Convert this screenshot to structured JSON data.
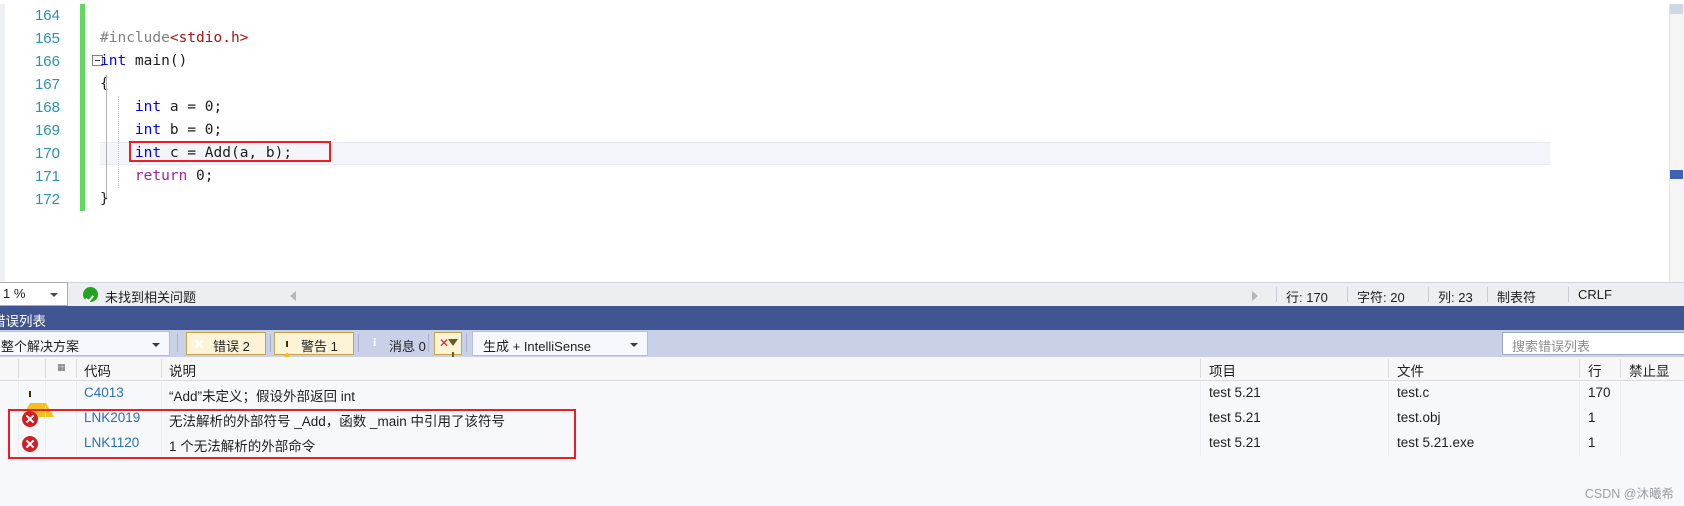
{
  "editor": {
    "lines": [
      {
        "num": "164",
        "tokens": [],
        "changed": true
      },
      {
        "num": "165",
        "tokens": [
          {
            "t": "#include",
            "c": "pp"
          },
          {
            "t": "<stdio.h>",
            "c": "str"
          }
        ],
        "changed": true
      },
      {
        "num": "166",
        "tokens": [
          {
            "t": "int",
            "c": "kw"
          },
          {
            "t": " main()",
            "c": "plain"
          }
        ],
        "changed": true
      },
      {
        "num": "167",
        "tokens": [
          {
            "t": "{",
            "c": "plain"
          }
        ],
        "changed": true
      },
      {
        "num": "168",
        "tokens": [
          {
            "t": "    ",
            "c": "plain"
          },
          {
            "t": "int",
            "c": "kw"
          },
          {
            "t": " a = 0;",
            "c": "plain"
          }
        ],
        "changed": true
      },
      {
        "num": "169",
        "tokens": [
          {
            "t": "    ",
            "c": "plain"
          },
          {
            "t": "int",
            "c": "kw"
          },
          {
            "t": " b = 0;",
            "c": "plain"
          }
        ],
        "changed": true
      },
      {
        "num": "170",
        "tokens": [
          {
            "t": "    ",
            "c": "plain"
          },
          {
            "t": "int",
            "c": "kw"
          },
          {
            "t": " c = Add(a, b);",
            "c": "plain"
          }
        ],
        "changed": true
      },
      {
        "num": "171",
        "tokens": [
          {
            "t": "    ",
            "c": "plain"
          },
          {
            "t": "return",
            "c": "kw2"
          },
          {
            "t": " 0;",
            "c": "plain"
          }
        ],
        "changed": true
      },
      {
        "num": "172",
        "tokens": [
          {
            "t": "}",
            "c": "plain"
          }
        ],
        "changed": true
      }
    ],
    "highlight_line_index": 6,
    "collapse_glyph_line_index": 2
  },
  "status_bar": {
    "zoom_value": "1 %",
    "issues_text": "未找到相关问题",
    "line_label": "行: 170",
    "char_label": "字符: 20",
    "col_label": "列: 23",
    "tab_label": "制表符",
    "eol_label": "CRLF"
  },
  "error_panel": {
    "title": "错误列表",
    "scope_value": "整个解决方案",
    "toggles": [
      {
        "icon": "error-icon",
        "label": "错误 2"
      },
      {
        "icon": "warning-icon",
        "label": "警告 1"
      },
      {
        "icon": "info-icon",
        "label": "消息 0"
      }
    ],
    "filter_icon": "clear-filter-icon",
    "build_value": "生成 + IntelliSense",
    "search_placeholder": "搜索错误列表",
    "columns": {
      "code": "代码",
      "description": "说明",
      "project": "项目",
      "file": "文件",
      "line": "行",
      "suppress": "禁止显"
    },
    "rows": [
      {
        "severity": "warning",
        "code": "C4013",
        "description": "“Add”未定义；假设外部返回 int",
        "project": "test 5.21",
        "file": "test.c",
        "line": "170"
      },
      {
        "severity": "error",
        "code": "LNK2019",
        "description": "无法解析的外部符号 _Add，函数 _main 中引用了该符号",
        "project": "test 5.21",
        "file": "test.obj",
        "line": "1"
      },
      {
        "severity": "error",
        "code": "LNK1120",
        "description": "1 个无法解析的外部命令",
        "project": "test 5.21",
        "file": "test 5.21.exe",
        "line": "1"
      }
    ]
  },
  "watermark": "CSDN @沐曦希",
  "colors": {
    "panel_header": "#3f5490",
    "toolbar": "#c8d1e8",
    "accent_red": "#ee1c23",
    "code_link": "#2a6fba",
    "change_bar": "#62d862"
  }
}
